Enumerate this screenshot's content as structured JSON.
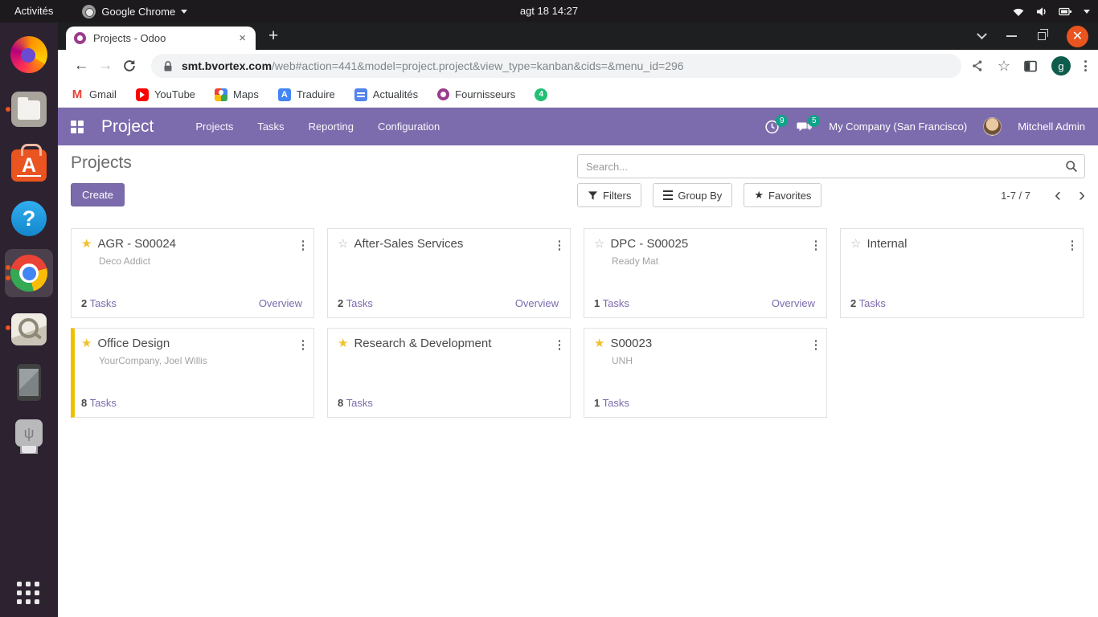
{
  "colors": {
    "accent": "#7C6BAD",
    "badge": "#0FA489",
    "star": "#F0C12C",
    "close_button": "#E9541F",
    "card_highlight": "#F0C000"
  },
  "system_bar": {
    "activities_label": "Activités",
    "app_menu_label": "Google Chrome",
    "clock": "agt 18  14:27"
  },
  "browser": {
    "tab_title": "Projects - Odoo",
    "new_tab_label": "+",
    "url_host": "smt.bvortex.com",
    "url_path": "/web#action=441&model=project.project&view_type=kanban&cids=&menu_id=296",
    "profile_initial": "g",
    "bookmarks": [
      {
        "label": "Gmail"
      },
      {
        "label": "YouTube"
      },
      {
        "label": "Maps"
      },
      {
        "label": "Traduire"
      },
      {
        "label": "Actualités"
      },
      {
        "label": "Fournisseurs"
      },
      {
        "label": ""
      }
    ]
  },
  "odoo": {
    "app_name": "Project",
    "menus": [
      {
        "label": "Projects"
      },
      {
        "label": "Tasks"
      },
      {
        "label": "Reporting"
      },
      {
        "label": "Configuration"
      }
    ],
    "activities_badge": "9",
    "messages_badge": "5",
    "company_name": "My Company (San Francisco)",
    "user_name": "Mitchell Admin"
  },
  "control_panel": {
    "page_title": "Projects",
    "create_label": "Create",
    "search_placeholder": "Search...",
    "filters_label": "Filters",
    "group_by_label": "Group By",
    "favorites_label": "Favorites",
    "pager_text": "1-7 / 7"
  },
  "kanban": {
    "cards": [
      {
        "title": "AGR - S00024",
        "subtitle": "Deco Addict",
        "tasks_count": "2",
        "tasks_label": "Tasks",
        "overview_label": "Overview",
        "starred": true
      },
      {
        "title": "After-Sales Services",
        "subtitle": "",
        "tasks_count": "2",
        "tasks_label": "Tasks",
        "overview_label": "Overview",
        "starred": false
      },
      {
        "title": "DPC - S00025",
        "subtitle": "Ready Mat",
        "tasks_count": "1",
        "tasks_label": "Tasks",
        "overview_label": "Overview",
        "starred": false
      },
      {
        "title": "Internal",
        "subtitle": "",
        "tasks_count": "2",
        "tasks_label": "Tasks",
        "starred": false
      },
      {
        "title": "Office Design",
        "subtitle": "YourCompany, Joel Willis",
        "tasks_count": "8",
        "tasks_label": "Tasks",
        "starred": true,
        "highlighted": true
      },
      {
        "title": "Research & Development",
        "subtitle": "",
        "tasks_count": "8",
        "tasks_label": "Tasks",
        "starred": true
      },
      {
        "title": "S00023",
        "subtitle": "UNH",
        "tasks_count": "1",
        "tasks_label": "Tasks",
        "starred": true
      }
    ]
  }
}
